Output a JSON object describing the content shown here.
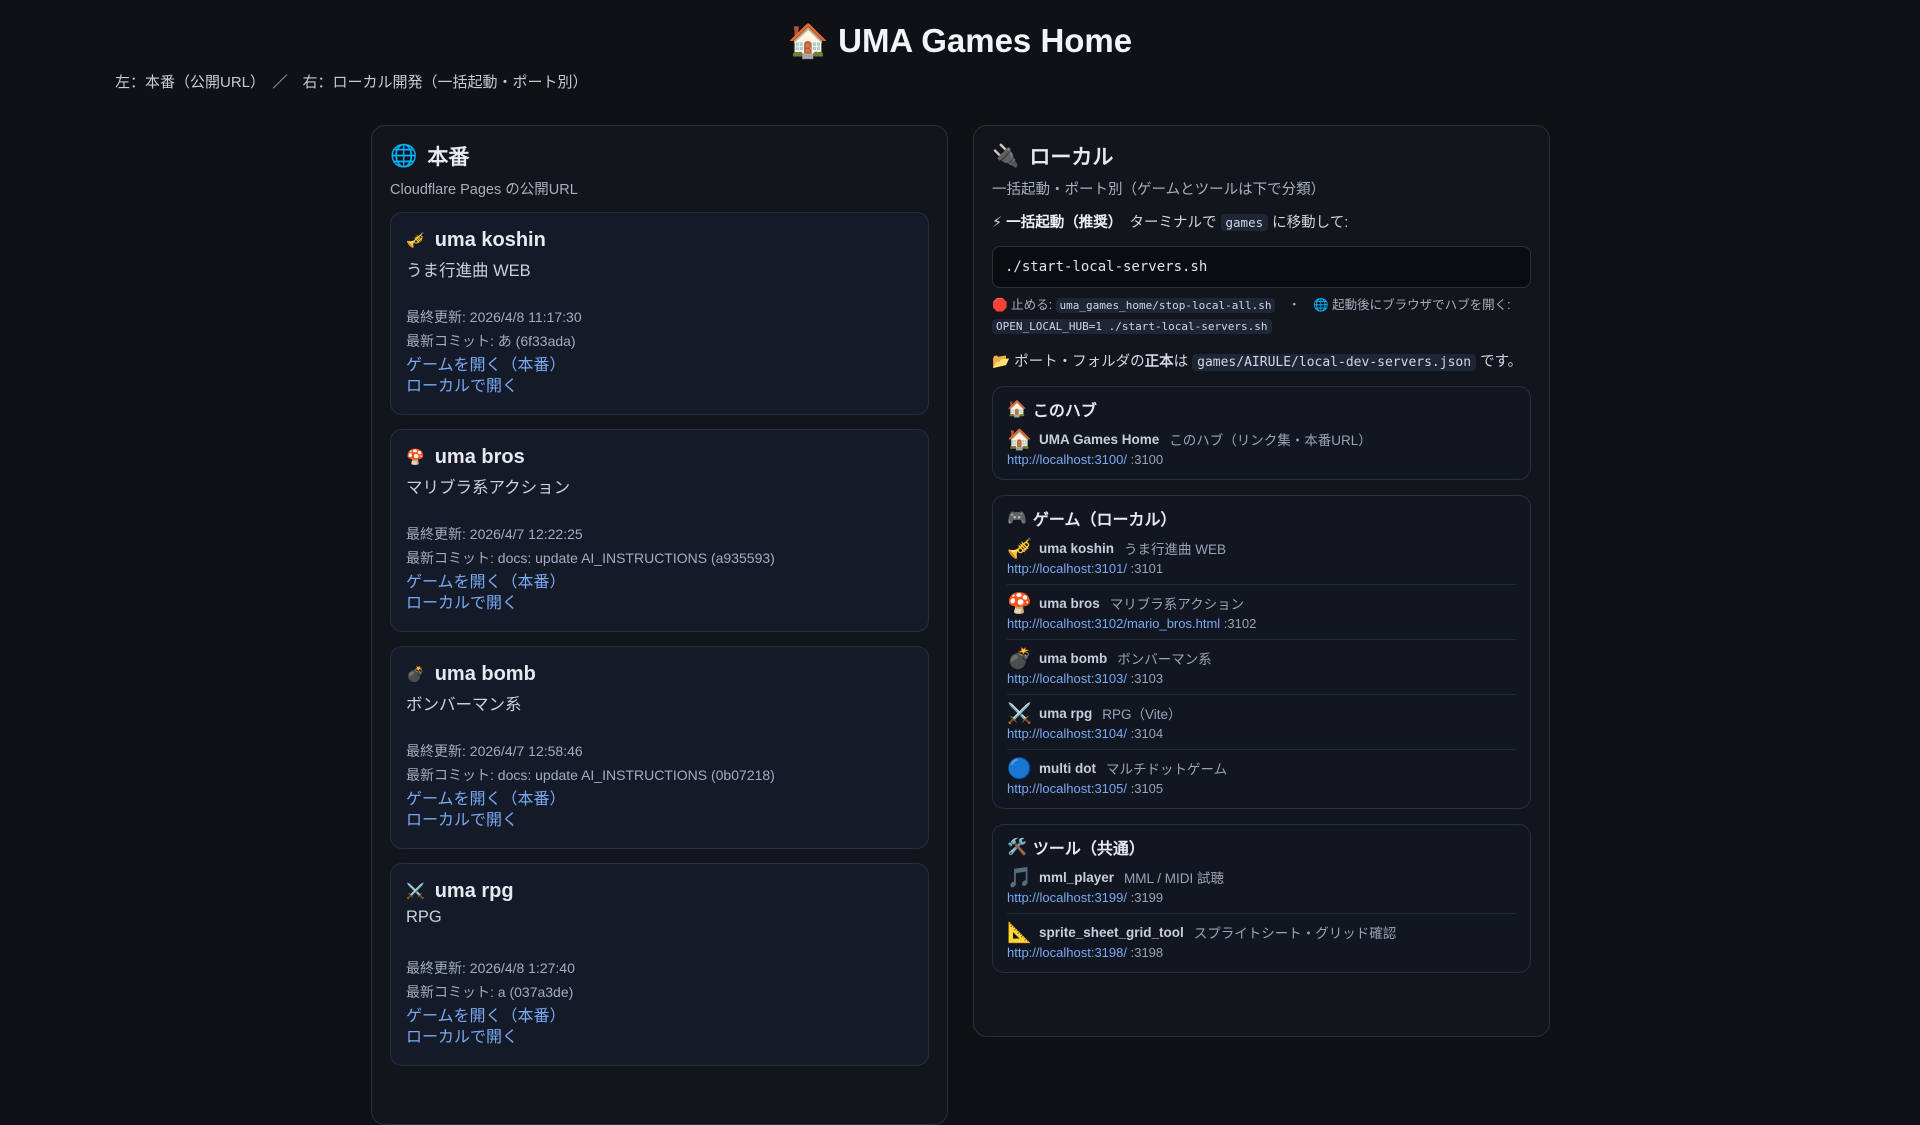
{
  "header": {
    "icon": "🏠",
    "title": "UMA Games Home",
    "subtitle": "左：本番（公開URL）　／　右：ローカル開発（一括起動・ポート別）"
  },
  "left": {
    "icon": "🌐",
    "title": "本番",
    "desc": "Cloudflare Pages の公開URL",
    "cards": [
      {
        "icon": "🎺",
        "name": "uma koshin",
        "subtitle": "うま行進曲 WEB",
        "updated": "最終更新: 2026/4/8 11:17:30",
        "commit": "最新コミット: あ (6f33ada)",
        "open_prod": "ゲームを開く（本番）",
        "open_local": "ローカルで開く"
      },
      {
        "icon": "🍄",
        "name": "uma bros",
        "subtitle": "マリブラ系アクション",
        "updated": "最終更新: 2026/4/7 12:22:25",
        "commit": "最新コミット: docs: update AI_INSTRUCTIONS (a935593)",
        "open_prod": "ゲームを開く（本番）",
        "open_local": "ローカルで開く"
      },
      {
        "icon": "💣",
        "name": "uma bomb",
        "subtitle": "ボンバーマン系",
        "updated": "最終更新: 2026/4/7 12:58:46",
        "commit": "最新コミット: docs: update AI_INSTRUCTIONS (0b07218)",
        "open_prod": "ゲームを開く（本番）",
        "open_local": "ローカルで開く"
      },
      {
        "icon": "⚔️",
        "name": "uma rpg",
        "subtitle": "RPG",
        "updated": "最終更新: 2026/4/8 1:27:40",
        "commit": "最新コミット: a (037a3de)",
        "open_prod": "ゲームを開く（本番）",
        "open_local": "ローカルで開く"
      }
    ]
  },
  "right": {
    "icon": "🔌",
    "title": "ローカル",
    "desc": "一括起動・ポート別（ゲームとツールは下で分類）",
    "quick_icon": "⚡",
    "quick_label": "一括起動（推奨）",
    "quick_text": "ターミナルで",
    "quick_dir": "games",
    "quick_after": "に移動して:",
    "command": "./start-local-servers.sh",
    "stop_icon": "🛑",
    "stop_label": "止める:",
    "stop_cmd": "uma_games_home/stop-local-all.sh",
    "sep": "・",
    "hub_icon": "🌐",
    "hub_label": "起動後にブラウザでハブを開く:",
    "hub_cmd": "OPEN_LOCAL_HUB=1 ./start-local-servers.sh",
    "ports_icon": "📂",
    "ports_pre": "ポート・フォルダの",
    "ports_bold": "正本",
    "ports_mid": "は",
    "ports_file": "games/AIRULE/local-dev-servers.json",
    "ports_post": "です。",
    "sections": [
      {
        "icon": "🏠",
        "title": "このハブ",
        "items": [
          {
            "icon": "🏠",
            "name": "UMA Games Home",
            "desc": "このハブ（リンク集・本番URL）",
            "url": "http://localhost:3100/",
            "port": ":3100"
          }
        ]
      },
      {
        "icon": "🎮",
        "title": "ゲーム（ローカル）",
        "items": [
          {
            "icon": "🎺",
            "name": "uma koshin",
            "desc": "うま行進曲 WEB",
            "url": "http://localhost:3101/",
            "port": ":3101"
          },
          {
            "icon": "🍄",
            "name": "uma bros",
            "desc": "マリブラ系アクション",
            "url": "http://localhost:3102/mario_bros.html",
            "port": ":3102"
          },
          {
            "icon": "💣",
            "name": "uma bomb",
            "desc": "ボンバーマン系",
            "url": "http://localhost:3103/",
            "port": ":3103"
          },
          {
            "icon": "⚔️",
            "name": "uma rpg",
            "desc": "RPG（Vite）",
            "url": "http://localhost:3104/",
            "port": ":3104"
          },
          {
            "icon": "🔵",
            "name": "multi dot",
            "desc": "マルチドットゲーム",
            "url": "http://localhost:3105/",
            "port": ":3105"
          }
        ]
      },
      {
        "icon": "🛠️",
        "title": "ツール（共通）",
        "items": [
          {
            "icon": "🎵",
            "name": "mml_player",
            "desc": "MML / MIDI 試聴",
            "url": "http://localhost:3199/",
            "port": ":3199"
          },
          {
            "icon": "📐",
            "name": "sprite_sheet_grid_tool",
            "desc": "スプライトシート・グリッド確認",
            "url": "http://localhost:3198/",
            "port": ":3198"
          }
        ]
      }
    ]
  }
}
